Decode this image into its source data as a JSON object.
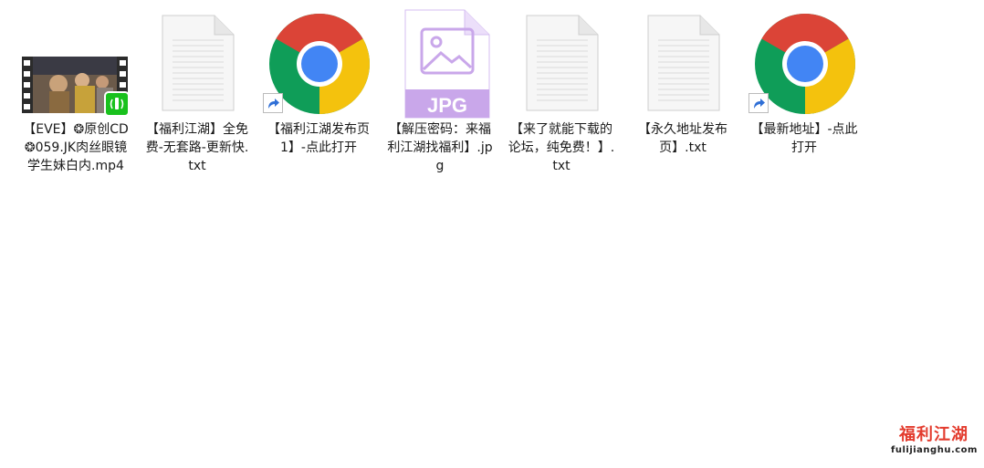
{
  "files": [
    {
      "name": "【EVE】❂原创CD❂059.JK肉丝眼镜学生妹白内.mp4",
      "type": "video"
    },
    {
      "name": "【福利江湖】全免费-无套路-更新快.txt",
      "type": "text"
    },
    {
      "name": "【福利江湖发布页1】-点此打开",
      "type": "chrome-shortcut"
    },
    {
      "name": "【解压密码：来福利江湖找福利】.jpg",
      "type": "image"
    },
    {
      "name": "【来了就能下载的论坛，纯免费！】.txt",
      "type": "text"
    },
    {
      "name": "【永久地址发布页】.txt",
      "type": "text"
    },
    {
      "name": "【最新地址】-点此打开",
      "type": "chrome-shortcut"
    }
  ],
  "jpg_badge": "JPG",
  "watermark": {
    "title": "福利江湖",
    "url": "fulijianghu.com"
  },
  "colors": {
    "chrome_red": "#db4437",
    "chrome_yellow": "#f4c20d",
    "chrome_green": "#0f9d58",
    "chrome_blue": "#4285f4",
    "jpg_purple": "#c9a7ea",
    "badge_green": "#19c11d",
    "shortcut_arrow": "#2f6fd6"
  }
}
